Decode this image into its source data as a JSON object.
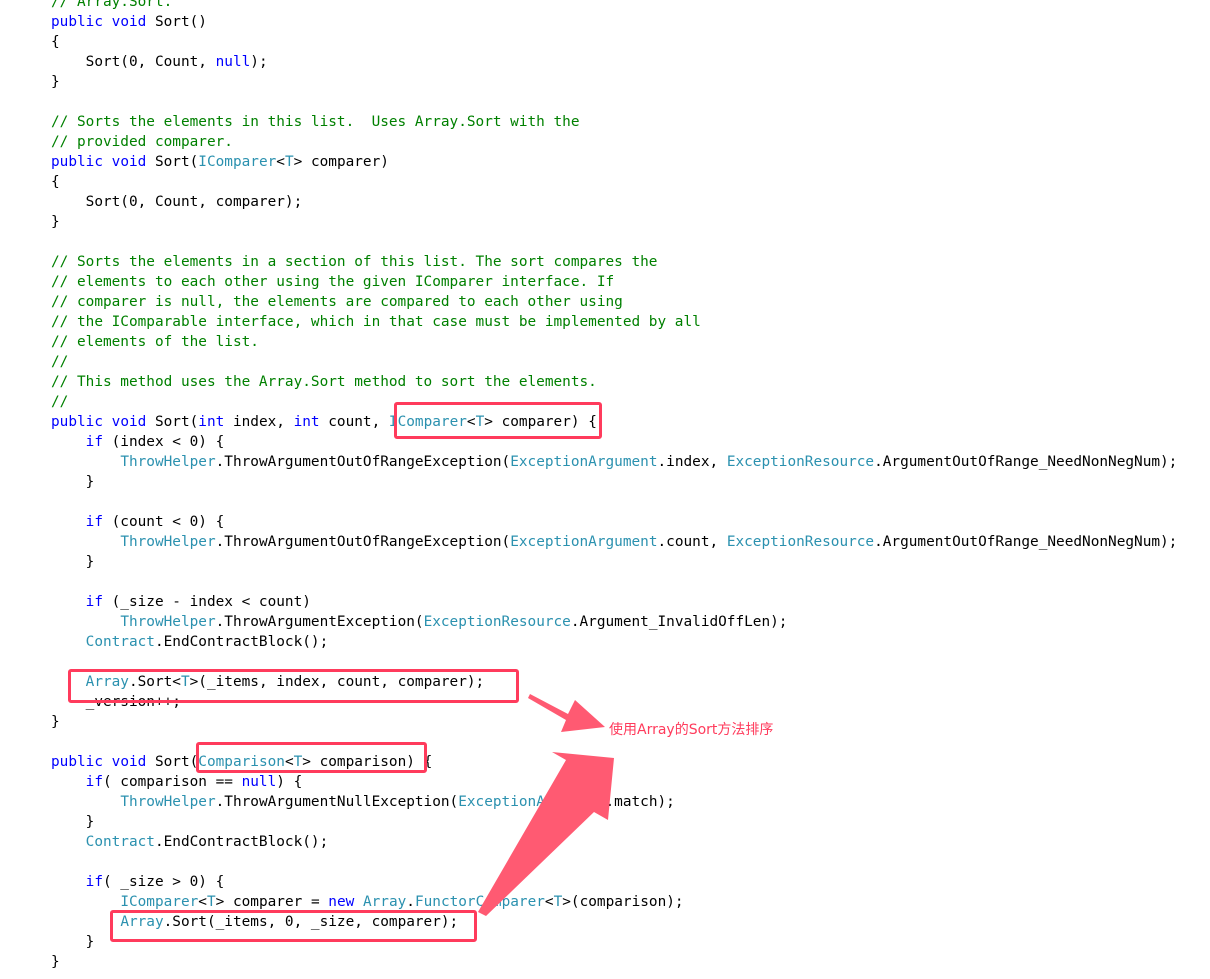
{
  "code_lines": [
    [
      {
        "t": "// Array.Sort.",
        "c": "cm"
      }
    ],
    [
      {
        "t": "public",
        "c": "kw"
      },
      {
        "t": " ",
        "c": "tx"
      },
      {
        "t": "void",
        "c": "kw"
      },
      {
        "t": " Sort()",
        "c": "tx"
      }
    ],
    [
      {
        "t": "{",
        "c": "tx"
      }
    ],
    [
      {
        "t": "    Sort(0, Count, ",
        "c": "tx"
      },
      {
        "t": "null",
        "c": "kw"
      },
      {
        "t": ");",
        "c": "tx"
      }
    ],
    [
      {
        "t": "}",
        "c": "tx"
      }
    ],
    [],
    [
      {
        "t": "// Sorts the elements in this list.  Uses Array.Sort with the",
        "c": "cm"
      }
    ],
    [
      {
        "t": "// provided comparer.",
        "c": "cm"
      }
    ],
    [
      {
        "t": "public",
        "c": "kw"
      },
      {
        "t": " ",
        "c": "tx"
      },
      {
        "t": "void",
        "c": "kw"
      },
      {
        "t": " Sort(",
        "c": "tx"
      },
      {
        "t": "IComparer",
        "c": "tp"
      },
      {
        "t": "<",
        "c": "tx"
      },
      {
        "t": "T",
        "c": "tp"
      },
      {
        "t": "> comparer)",
        "c": "tx"
      }
    ],
    [
      {
        "t": "{",
        "c": "tx"
      }
    ],
    [
      {
        "t": "    Sort(0, Count, comparer);",
        "c": "tx"
      }
    ],
    [
      {
        "t": "}",
        "c": "tx"
      }
    ],
    [],
    [
      {
        "t": "// Sorts the elements in a section of this list. The sort compares the",
        "c": "cm"
      }
    ],
    [
      {
        "t": "// elements to each other using the given IComparer interface. If",
        "c": "cm"
      }
    ],
    [
      {
        "t": "// comparer is null, the elements are compared to each other using",
        "c": "cm"
      }
    ],
    [
      {
        "t": "// the IComparable interface, which in that case must be implemented by all",
        "c": "cm"
      }
    ],
    [
      {
        "t": "// elements of the list.",
        "c": "cm"
      }
    ],
    [
      {
        "t": "//",
        "c": "cm"
      }
    ],
    [
      {
        "t": "// This method uses the Array.Sort method to sort the elements.",
        "c": "cm"
      }
    ],
    [
      {
        "t": "//",
        "c": "cm"
      }
    ],
    [
      {
        "t": "public",
        "c": "kw"
      },
      {
        "t": " ",
        "c": "tx"
      },
      {
        "t": "void",
        "c": "kw"
      },
      {
        "t": " Sort(",
        "c": "tx"
      },
      {
        "t": "int",
        "c": "kw"
      },
      {
        "t": " index, ",
        "c": "tx"
      },
      {
        "t": "int",
        "c": "kw"
      },
      {
        "t": " count, ",
        "c": "tx"
      },
      {
        "t": "IComparer",
        "c": "tp"
      },
      {
        "t": "<",
        "c": "tx"
      },
      {
        "t": "T",
        "c": "tp"
      },
      {
        "t": "> comparer) {",
        "c": "tx"
      }
    ],
    [
      {
        "t": "    ",
        "c": "tx"
      },
      {
        "t": "if",
        "c": "kw"
      },
      {
        "t": " (index < 0) {",
        "c": "tx"
      }
    ],
    [
      {
        "t": "        ",
        "c": "tx"
      },
      {
        "t": "ThrowHelper",
        "c": "tp"
      },
      {
        "t": ".ThrowArgumentOutOfRangeException(",
        "c": "tx"
      },
      {
        "t": "ExceptionArgument",
        "c": "tp"
      },
      {
        "t": ".index, ",
        "c": "tx"
      },
      {
        "t": "ExceptionResource",
        "c": "tp"
      },
      {
        "t": ".ArgumentOutOfRange_NeedNonNegNum);",
        "c": "tx"
      }
    ],
    [
      {
        "t": "    }",
        "c": "tx"
      }
    ],
    [],
    [
      {
        "t": "    ",
        "c": "tx"
      },
      {
        "t": "if",
        "c": "kw"
      },
      {
        "t": " (count < 0) {",
        "c": "tx"
      }
    ],
    [
      {
        "t": "        ",
        "c": "tx"
      },
      {
        "t": "ThrowHelper",
        "c": "tp"
      },
      {
        "t": ".ThrowArgumentOutOfRangeException(",
        "c": "tx"
      },
      {
        "t": "ExceptionArgument",
        "c": "tp"
      },
      {
        "t": ".count, ",
        "c": "tx"
      },
      {
        "t": "ExceptionResource",
        "c": "tp"
      },
      {
        "t": ".ArgumentOutOfRange_NeedNonNegNum);",
        "c": "tx"
      }
    ],
    [
      {
        "t": "    }",
        "c": "tx"
      }
    ],
    [],
    [
      {
        "t": "    ",
        "c": "tx"
      },
      {
        "t": "if",
        "c": "kw"
      },
      {
        "t": " (_size - index < count)",
        "c": "tx"
      }
    ],
    [
      {
        "t": "        ",
        "c": "tx"
      },
      {
        "t": "ThrowHelper",
        "c": "tp"
      },
      {
        "t": ".ThrowArgumentException(",
        "c": "tx"
      },
      {
        "t": "ExceptionResource",
        "c": "tp"
      },
      {
        "t": ".Argument_InvalidOffLen);",
        "c": "tx"
      }
    ],
    [
      {
        "t": "    ",
        "c": "tx"
      },
      {
        "t": "Contract",
        "c": "tp"
      },
      {
        "t": ".EndContractBlock();",
        "c": "tx"
      }
    ],
    [],
    [
      {
        "t": "    ",
        "c": "tx"
      },
      {
        "t": "Array",
        "c": "tp"
      },
      {
        "t": ".Sort<",
        "c": "tx"
      },
      {
        "t": "T",
        "c": "tp"
      },
      {
        "t": ">(_items, index, count, comparer);",
        "c": "tx"
      }
    ],
    [
      {
        "t": "    _version++;",
        "c": "tx"
      }
    ],
    [
      {
        "t": "}",
        "c": "tx"
      }
    ],
    [],
    [
      {
        "t": "public",
        "c": "kw"
      },
      {
        "t": " ",
        "c": "tx"
      },
      {
        "t": "void",
        "c": "kw"
      },
      {
        "t": " Sort(",
        "c": "tx"
      },
      {
        "t": "Comparison",
        "c": "tp"
      },
      {
        "t": "<",
        "c": "tx"
      },
      {
        "t": "T",
        "c": "tp"
      },
      {
        "t": "> comparison) {",
        "c": "tx"
      }
    ],
    [
      {
        "t": "    ",
        "c": "tx"
      },
      {
        "t": "if",
        "c": "kw"
      },
      {
        "t": "( comparison == ",
        "c": "tx"
      },
      {
        "t": "null",
        "c": "kw"
      },
      {
        "t": ") {",
        "c": "tx"
      }
    ],
    [
      {
        "t": "        ",
        "c": "tx"
      },
      {
        "t": "ThrowHelper",
        "c": "tp"
      },
      {
        "t": ".ThrowArgumentNullException(",
        "c": "tx"
      },
      {
        "t": "ExceptionArgument",
        "c": "tp"
      },
      {
        "t": ".match);",
        "c": "tx"
      }
    ],
    [
      {
        "t": "    }",
        "c": "tx"
      }
    ],
    [
      {
        "t": "    ",
        "c": "tx"
      },
      {
        "t": "Contract",
        "c": "tp"
      },
      {
        "t": ".EndContractBlock();",
        "c": "tx"
      }
    ],
    [],
    [
      {
        "t": "    ",
        "c": "tx"
      },
      {
        "t": "if",
        "c": "kw"
      },
      {
        "t": "( _size > 0) {",
        "c": "tx"
      }
    ],
    [
      {
        "t": "        ",
        "c": "tx"
      },
      {
        "t": "IComparer",
        "c": "tp"
      },
      {
        "t": "<",
        "c": "tx"
      },
      {
        "t": "T",
        "c": "tp"
      },
      {
        "t": "> comparer = ",
        "c": "tx"
      },
      {
        "t": "new",
        "c": "kw"
      },
      {
        "t": " ",
        "c": "tx"
      },
      {
        "t": "Array",
        "c": "tp"
      },
      {
        "t": ".",
        "c": "tx"
      },
      {
        "t": "FunctorComparer",
        "c": "tp"
      },
      {
        "t": "<",
        "c": "tx"
      },
      {
        "t": "T",
        "c": "tp"
      },
      {
        "t": ">(comparison);",
        "c": "tx"
      }
    ],
    [
      {
        "t": "        ",
        "c": "tx"
      },
      {
        "t": "Array",
        "c": "tp"
      },
      {
        "t": ".Sort(_items, 0, _size, comparer);",
        "c": "tx"
      }
    ],
    [
      {
        "t": "    }",
        "c": "tx"
      }
    ],
    [
      {
        "t": "}",
        "c": "tx"
      }
    ]
  ],
  "annotation": {
    "text": "使用Array的Sort方法排序"
  },
  "colors": {
    "keyword": "#0000ff",
    "comment": "#008000",
    "type": "#2b91af",
    "text": "#000000",
    "highlight": "#ff3b5c"
  }
}
